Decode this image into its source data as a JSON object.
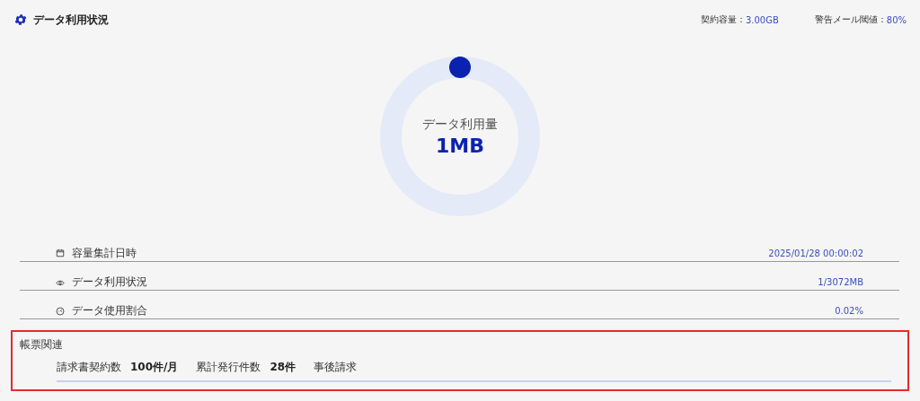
{
  "header": {
    "title": "データ利用状況",
    "contract_label": "契約容量：",
    "contract_value": "3.00GB",
    "alert_label": "警告メール閾値：",
    "alert_value": "80%"
  },
  "gauge": {
    "label": "データ利用量",
    "value": "1MB"
  },
  "rows": [
    {
      "kind": "calendar",
      "label": "容量集計日時",
      "value": "2025/01/28 00:00:02"
    },
    {
      "kind": "eye",
      "label": "データ利用状況",
      "value": "1/3072MB"
    },
    {
      "kind": "meter",
      "label": "データ使用割合",
      "value": "0.02%"
    }
  ],
  "billing": {
    "title": "帳票関連",
    "items": [
      {
        "label": "請求書契約数",
        "value": "100件/月"
      },
      {
        "label": "累計発行件数",
        "value": "28件"
      },
      {
        "label": "事後請求"
      }
    ]
  }
}
